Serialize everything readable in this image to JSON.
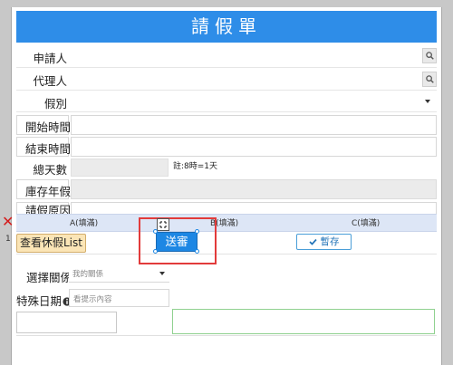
{
  "form": {
    "title": "請假單",
    "fields": {
      "applicant": {
        "label": "申請人",
        "value": ""
      },
      "agent": {
        "label": "代理人",
        "value": ""
      },
      "leave_type": {
        "label": "假別",
        "value": ""
      },
      "start_time": {
        "label": "開始時間",
        "value": ""
      },
      "end_time": {
        "label": "結束時間",
        "value": ""
      },
      "total_days": {
        "label": "總天數",
        "value": "",
        "note": "註:8時=1天"
      },
      "annual_leave": {
        "label": "庫存年假",
        "value": ""
      },
      "leave_reason": {
        "label": "請假原因",
        "value": ""
      }
    },
    "grid": {
      "delete_symbol": "✕",
      "columns": [
        "A(填滿)",
        "B(填滿)",
        "C(填滿)"
      ],
      "row_number": "1",
      "view_leave_button": "查看休假List",
      "submit_button": "送審",
      "save_button": "暫存",
      "save_icon": "check-icon"
    },
    "select_relation": {
      "label": "選擇關係",
      "placeholder": "我的關係"
    },
    "special_date": {
      "label": "特殊日期",
      "placeholder": "看提示內容",
      "icon": "info-icon"
    }
  },
  "colors": {
    "header_bg": "#2e8de8",
    "submit_bg": "#1d87e4",
    "list_button_bg": "#fbe5b6",
    "highlight_box": "#e23b3b",
    "green_border": "#8fd18f"
  }
}
